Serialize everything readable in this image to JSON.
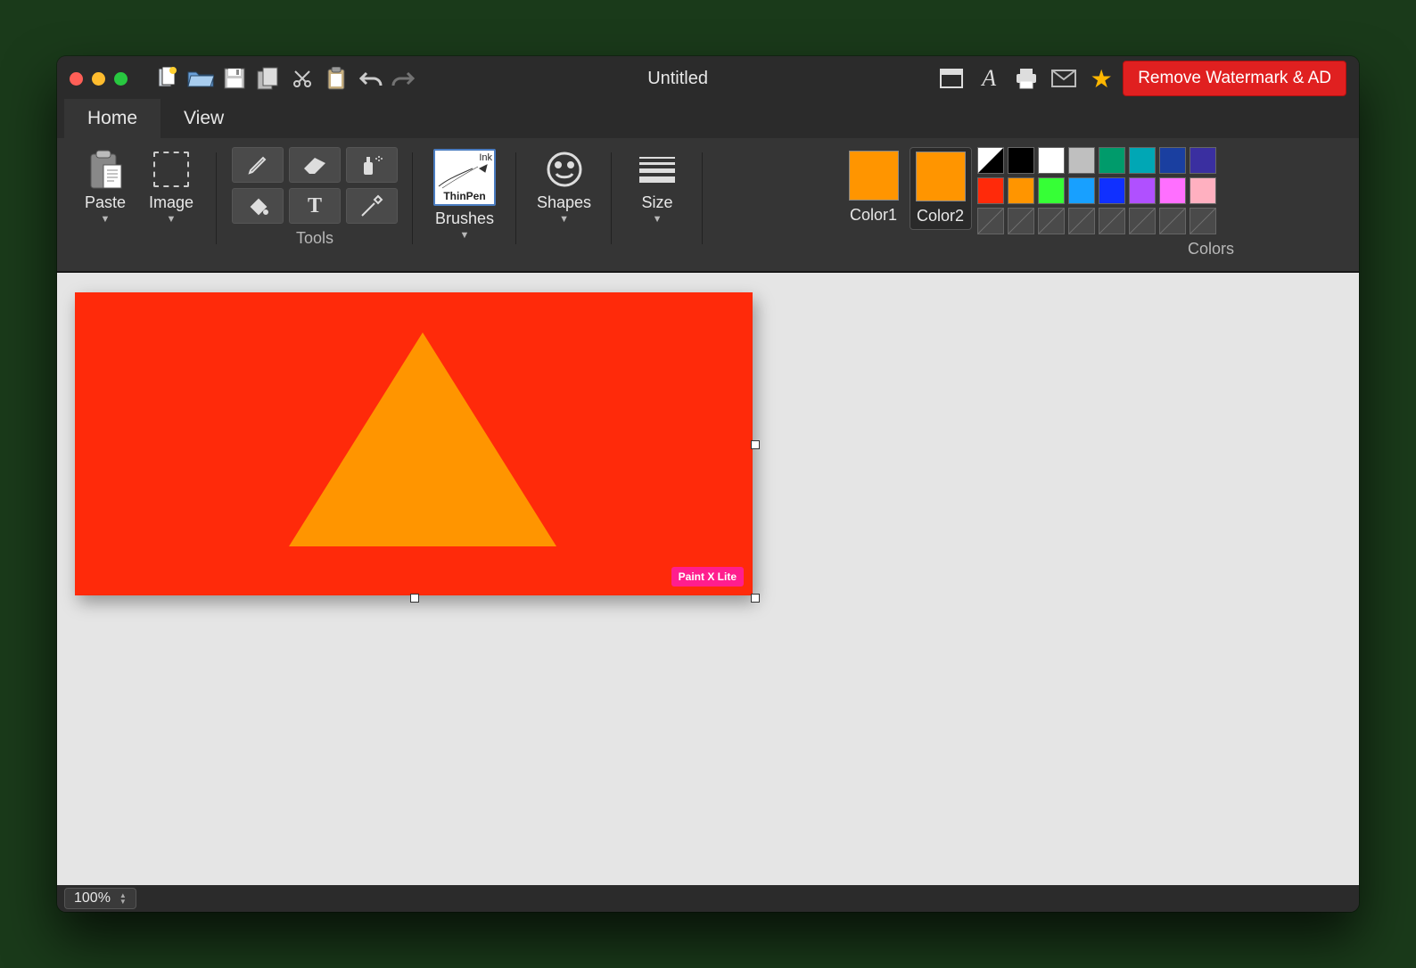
{
  "title": "Untitled",
  "tabs": {
    "home": "Home",
    "view": "View",
    "active": "home"
  },
  "toolbar": {
    "remove_watermark": "Remove Watermark & AD"
  },
  "ribbon": {
    "paste": "Paste",
    "image": "Image",
    "tools_label": "Tools",
    "brushes": "Brushes",
    "brush_thumb": {
      "ink": "Ink",
      "name": "ThinPen"
    },
    "shapes": "Shapes",
    "size": "Size",
    "color1": "Color1",
    "color2": "Color2",
    "colors_label": "Colors",
    "color1_value": "#ff9500",
    "color2_value": "#ff9500",
    "palette": [
      [
        "#ffffff/#000000",
        "#000000",
        "#ffffff",
        "#bfbfbf",
        "#009b6b",
        "#00a7b5",
        "#1a3fa0",
        "#3a2fa0"
      ],
      [
        "#ff2a0a",
        "#ff9500",
        "#36ff36",
        "#18a0ff",
        "#1030ff",
        "#b050ff",
        "#ff6fff",
        "#ffb0c0"
      ],
      [
        "empty",
        "empty",
        "empty",
        "empty",
        "empty",
        "empty",
        "empty",
        "empty"
      ]
    ]
  },
  "canvas": {
    "bg_color": "#ff2a0a",
    "triangle_color": "#ff9500",
    "watermark": "Paint X Lite"
  },
  "status": {
    "zoom": "100%"
  }
}
